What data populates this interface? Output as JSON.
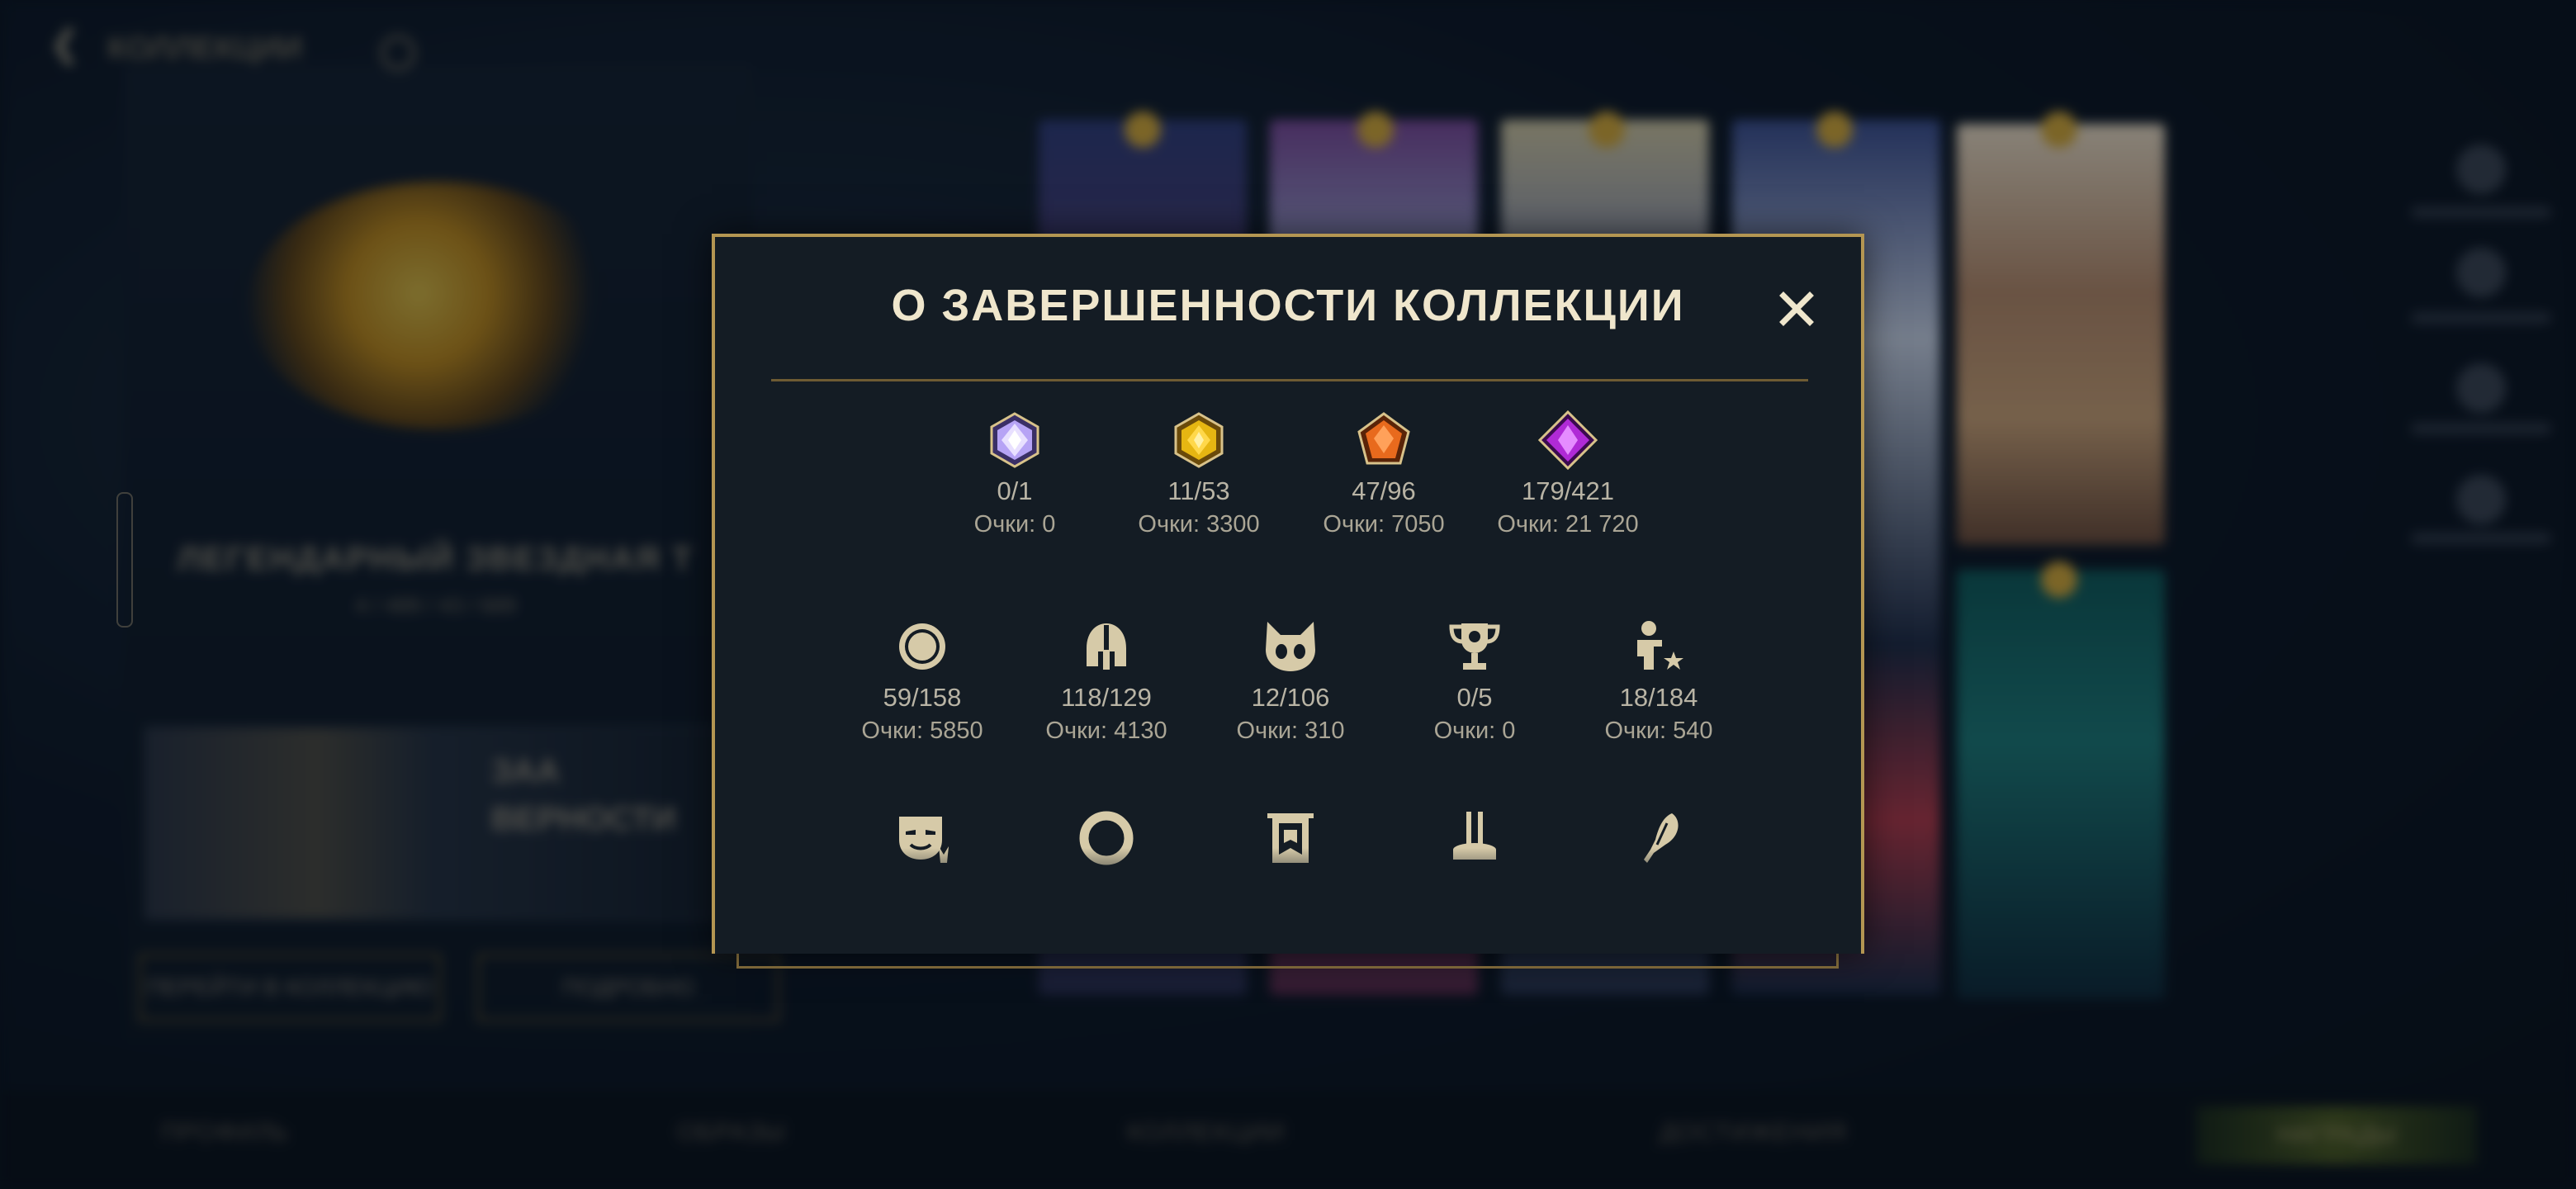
{
  "background": {
    "nav_back_label": "❮",
    "nav_title": "КОЛЛЕКЦИИ",
    "collection_title": "ЛЕГЕНДАРНЫЙ ЗВЕЗДНАЯ Т",
    "collection_subtitle": "4 / 489 / 43 / 689",
    "feature_title": "ЗАА ВЕРНОСТИ",
    "button_left": "ПЕРЕЙТИ В КОЛЛЕКЦИЮ",
    "button_right": "ПОДРОБНО",
    "bottom_tabs": [
      "ПРОФИЛЬ",
      "ОБРАЗЫ",
      "КОЛЛЕКЦИИ",
      "ДОСТИЖЕНИЯ"
    ],
    "bottom_button": "НАГРАДЫ"
  },
  "modal": {
    "title": "О ЗАВЕРШЕННОСТИ КОЛЛЕКЦИИ",
    "close_label": "✕",
    "row1": [
      {
        "icon": "diamond-rarity-icon",
        "count": "0/1",
        "points": "Очки: 0",
        "color": "#b9a6ff"
      },
      {
        "icon": "gold-rarity-icon",
        "count": "11/53",
        "points": "Очки: 3300",
        "color": "#e6b612"
      },
      {
        "icon": "orange-rarity-icon",
        "count": "47/96",
        "points": "Очки: 7050",
        "color": "#e86a1d"
      },
      {
        "icon": "purple-rarity-icon",
        "count": "179/421",
        "points": "Очки: 21 720",
        "color": "#b02ad6"
      }
    ],
    "row2": [
      {
        "icon": "coin-icon",
        "count": "59/158",
        "points": "Очки: 5850"
      },
      {
        "icon": "helmet-icon",
        "count": "118/129",
        "points": "Очки: 4130"
      },
      {
        "icon": "pet-icon",
        "count": "12/106",
        "points": "Очки: 310"
      },
      {
        "icon": "trophy-icon",
        "count": "0/5",
        "points": "Очки: 0"
      },
      {
        "icon": "person-star-icon",
        "count": "18/184",
        "points": "Очки: 540"
      }
    ],
    "row3": [
      {
        "icon": "mask-icon"
      },
      {
        "icon": "ring-icon"
      },
      {
        "icon": "banner-icon"
      },
      {
        "icon": "pedestal-icon"
      },
      {
        "icon": "feather-icon"
      }
    ]
  },
  "colors": {
    "accent_gold": "#b49652",
    "modal_bg": "#141c24",
    "title_text": "#efe6cc"
  }
}
